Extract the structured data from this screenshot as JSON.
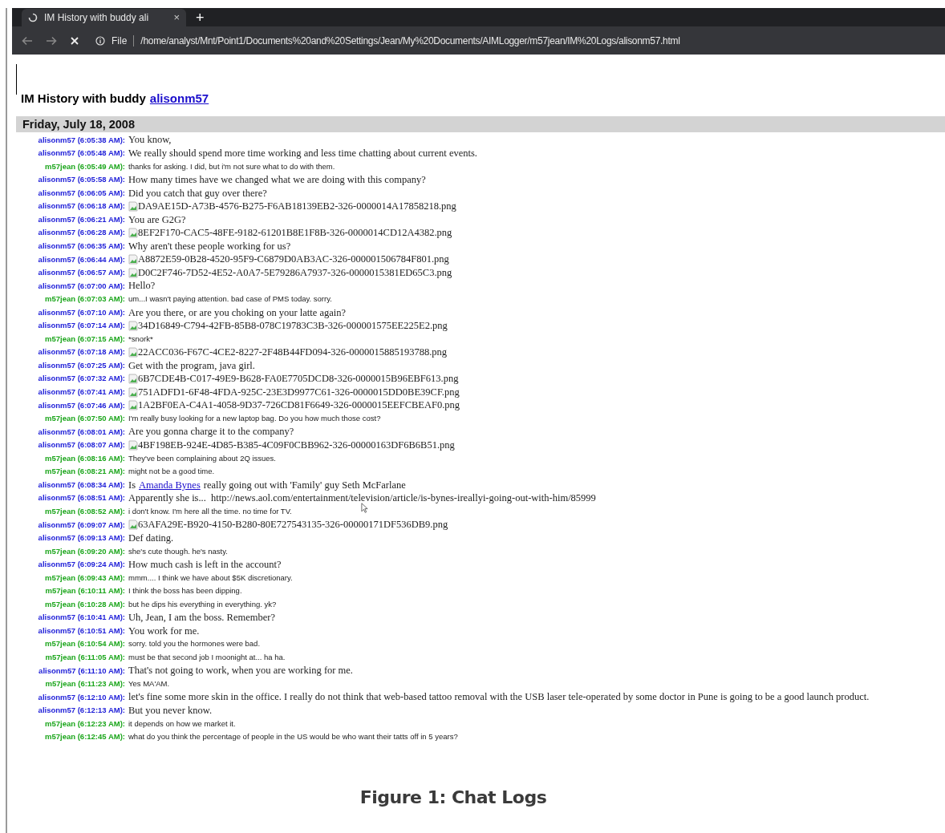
{
  "browser": {
    "tab": {
      "title": "IM History with buddy ali",
      "close": "×"
    },
    "new_tab": "+",
    "address_bar": {
      "scheme": "File",
      "url": "/home/analyst/Mnt/Point1/Documents%20and%20Settings/Jean/My%20Documents/AIMLogger/m57jean/IM%20Logs/alisonm57.html"
    }
  },
  "page": {
    "heading": "IM History with buddy",
    "buddy_link": "alisonm57",
    "date": "Friday, July 18, 2008",
    "messages": [
      {
        "outgoing": false,
        "label": "alisonm57 (6:05:38 AM):",
        "kind": "text",
        "text": "You know,"
      },
      {
        "outgoing": false,
        "label": "alisonm57 (6:05:48 AM):",
        "kind": "text",
        "text": "We really should spend more time working and less time chatting about current events."
      },
      {
        "outgoing": true,
        "label": "m57jean (6:05:49 AM):",
        "kind": "text",
        "text": "thanks for asking. I did, but i'm not sure what to do with them."
      },
      {
        "outgoing": false,
        "label": "alisonm57 (6:05:58 AM):",
        "kind": "text",
        "text": "How many times have we changed what we are doing with this company?"
      },
      {
        "outgoing": false,
        "label": "alisonm57 (6:06:05 AM):",
        "kind": "text",
        "text": "Did you catch that guy over there?"
      },
      {
        "outgoing": false,
        "label": "alisonm57 (6:06:18 AM):",
        "kind": "image",
        "text": "DA9AE15D-A73B-4576-B275-F6AB18139EB2-326-0000014A17858218.png"
      },
      {
        "outgoing": false,
        "label": "alisonm57 (6:06:21 AM):",
        "kind": "text",
        "text": "You are G2G?"
      },
      {
        "outgoing": false,
        "label": "alisonm57 (6:06:28 AM):",
        "kind": "image",
        "text": "8EF2F170-CAC5-48FE-9182-61201B8E1F8B-326-0000014CD12A4382.png"
      },
      {
        "outgoing": false,
        "label": "alisonm57 (6:06:35 AM):",
        "kind": "text",
        "text": "Why aren't these people working for us?"
      },
      {
        "outgoing": false,
        "label": "alisonm57 (6:06:44 AM):",
        "kind": "image",
        "text": "A8872E59-0B28-4520-95F9-C6879D0AB3AC-326-000001506784F801.png"
      },
      {
        "outgoing": false,
        "label": "alisonm57 (6:06:57 AM):",
        "kind": "image",
        "text": "D0C2F746-7D52-4E52-A0A7-5E79286A7937-326-0000015381ED65C3.png"
      },
      {
        "outgoing": false,
        "label": "alisonm57 (6:07:00 AM):",
        "kind": "text",
        "text": "Hello?"
      },
      {
        "outgoing": true,
        "label": "m57jean (6:07:03 AM):",
        "kind": "text",
        "text": "um...I wasn't paying attention. bad case of PMS today. sorry."
      },
      {
        "outgoing": false,
        "label": "alisonm57 (6:07:10 AM):",
        "kind": "text",
        "text": "Are you there, or are you choking on your latte again?"
      },
      {
        "outgoing": false,
        "label": "alisonm57 (6:07:14 AM):",
        "kind": "image",
        "text": "34D16849-C794-42FB-85B8-078C19783C3B-326-000001575EE225E2.png"
      },
      {
        "outgoing": true,
        "label": "m57jean (6:07:15 AM):",
        "kind": "text",
        "text": "*snork*"
      },
      {
        "outgoing": false,
        "label": "alisonm57 (6:07:18 AM):",
        "kind": "image",
        "text": "22ACC036-F67C-4CE2-8227-2F48B44FD094-326-0000015885193788.png"
      },
      {
        "outgoing": false,
        "label": "alisonm57 (6:07:25 AM):",
        "kind": "text",
        "text": "Get with the program, java girl."
      },
      {
        "outgoing": false,
        "label": "alisonm57 (6:07:32 AM):",
        "kind": "image",
        "text": "6B7CDE4B-C017-49E9-B628-FA0E7705DCD8-326-0000015B96EBF613.png"
      },
      {
        "outgoing": false,
        "label": "alisonm57 (6:07:41 AM):",
        "kind": "image",
        "text": "751ADFD1-6F48-4FDA-925C-23E3D9977C61-326-0000015DD0BE39CF.png"
      },
      {
        "outgoing": false,
        "label": "alisonm57 (6:07:46 AM):",
        "kind": "image",
        "text": "1A2BF0EA-C4A1-4058-9D37-726CD81F6649-326-0000015EEFCBEAF0.png"
      },
      {
        "outgoing": true,
        "label": "m57jean (6:07:50 AM):",
        "kind": "text",
        "text": "I'm really busy looking for a new laptop bag. Do you how much those cost?"
      },
      {
        "outgoing": false,
        "label": "alisonm57 (6:08:01 AM):",
        "kind": "text",
        "text": "Are you gonna charge it to the company?"
      },
      {
        "outgoing": false,
        "label": "alisonm57 (6:08:07 AM):",
        "kind": "image",
        "text": "4BF198EB-924E-4D85-B385-4C09F0CBB962-326-00000163DF6B6B51.png"
      },
      {
        "outgoing": true,
        "label": "m57jean (6:08:16 AM):",
        "kind": "text",
        "text": "They've been complaining about 2Q issues."
      },
      {
        "outgoing": true,
        "label": "m57jean (6:08:21 AM):",
        "kind": "text",
        "text": "might not be a good time."
      },
      {
        "outgoing": false,
        "label": "alisonm57 (6:08:34 AM):",
        "kind": "link",
        "before": "Is",
        "link": "Amanda Bynes",
        "text": "really going out with 'Family' guy Seth McFarlane"
      },
      {
        "outgoing": false,
        "label": "alisonm57 (6:08:51 AM):",
        "kind": "text",
        "text": "Apparently she is...  http://news.aol.com/entertainment/television/article/is-bynes-ireallyi-going-out-with-him/85999"
      },
      {
        "outgoing": true,
        "label": "m57jean (6:08:52 AM):",
        "kind": "text",
        "text": "i don't know. I'm here all the time. no time for TV."
      },
      {
        "outgoing": false,
        "label": "alisonm57 (6:09:07 AM):",
        "kind": "image",
        "text": "63AFA29E-B920-4150-B280-80E727543135-326-00000171DF536DB9.png"
      },
      {
        "outgoing": false,
        "label": "alisonm57 (6:09:13 AM):",
        "kind": "text",
        "text": "Def dating."
      },
      {
        "outgoing": true,
        "label": "m57jean (6:09:20 AM):",
        "kind": "text",
        "text": "she's cute though. he's nasty."
      },
      {
        "outgoing": false,
        "label": "alisonm57 (6:09:24 AM):",
        "kind": "text",
        "text": "How much cash is left in the account?"
      },
      {
        "outgoing": true,
        "label": "m57jean (6:09:43 AM):",
        "kind": "text",
        "text": "mmm.... I think we have about $5K discretionary."
      },
      {
        "outgoing": true,
        "label": "m57jean (6:10:11 AM):",
        "kind": "text",
        "text": "I think the boss has been dipping."
      },
      {
        "outgoing": true,
        "label": "m57jean (6:10:28 AM):",
        "kind": "text",
        "text": "but he dips his everything in everything. yk?"
      },
      {
        "outgoing": false,
        "label": "alisonm57 (6:10:41 AM):",
        "kind": "text",
        "text": "Uh, Jean, I am the boss. Remember?"
      },
      {
        "outgoing": false,
        "label": "alisonm57 (6:10:51 AM):",
        "kind": "text",
        "text": "You work for me."
      },
      {
        "outgoing": true,
        "label": "m57jean (6:10:54 AM):",
        "kind": "text",
        "text": "sorry. told you the hormones were bad."
      },
      {
        "outgoing": true,
        "label": "m57jean (6:11:05 AM):",
        "kind": "text",
        "text": "must be that second job I moonight at... ha ha."
      },
      {
        "outgoing": false,
        "label": "alisonm57 (6:11:10 AM):",
        "kind": "text",
        "text": "That's not going to work, when you are working for me."
      },
      {
        "outgoing": true,
        "label": "m57jean (6:11:23 AM):",
        "kind": "text",
        "text": "Yes MA'AM."
      },
      {
        "outgoing": false,
        "label": "alisonm57 (6:12:10 AM):",
        "kind": "text",
        "text": "let's fine some more skin in the office. I really do not think that web-based tattoo removal with the USB laser tele-operated by some doctor in Pune is going to be a good launch product."
      },
      {
        "outgoing": false,
        "label": "alisonm57 (6:12:13 AM):",
        "kind": "text",
        "text": "But you never know."
      },
      {
        "outgoing": true,
        "label": "m57jean (6:12:23 AM):",
        "kind": "text",
        "text": "it depends on how we market it."
      },
      {
        "outgoing": true,
        "label": "m57jean (6:12:45 AM):",
        "kind": "text",
        "text": "what do you think the percentage of people in the US would be who want their tatts off in 5 years?"
      }
    ]
  },
  "caption": "Figure 1: Chat Logs"
}
